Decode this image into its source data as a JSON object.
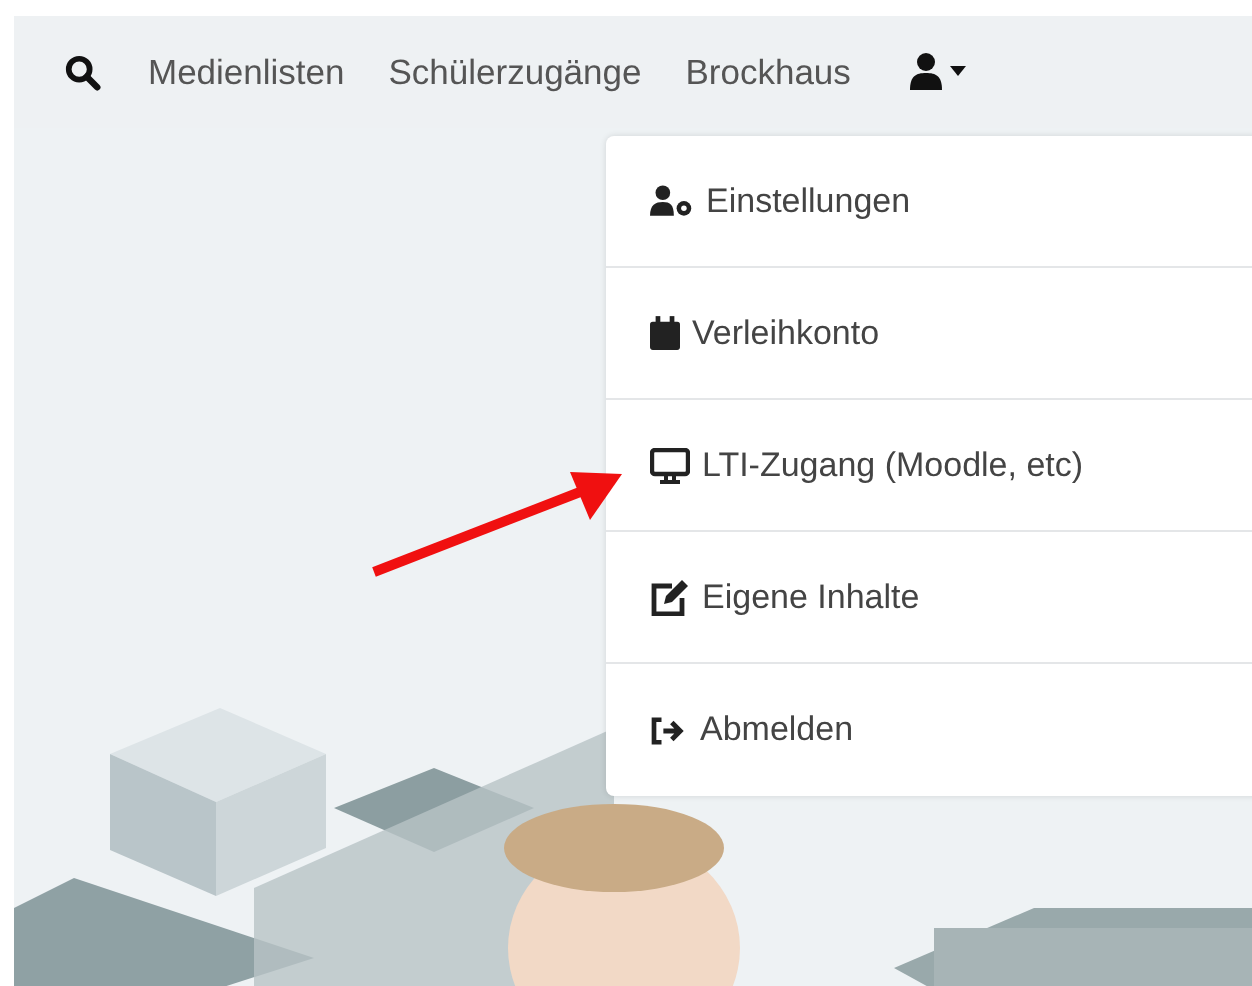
{
  "nav": {
    "links": [
      "Medienlisten",
      "Schülerzugänge",
      "Brockhaus"
    ]
  },
  "user_menu": {
    "expanded": true,
    "items": [
      {
        "label": "Einstellungen"
      },
      {
        "label": "Verleihkonto"
      },
      {
        "label": "LTI-Zugang (Moodle, etc)"
      },
      {
        "label": "Eigene Inhalte"
      },
      {
        "label": "Abmelden"
      }
    ]
  }
}
